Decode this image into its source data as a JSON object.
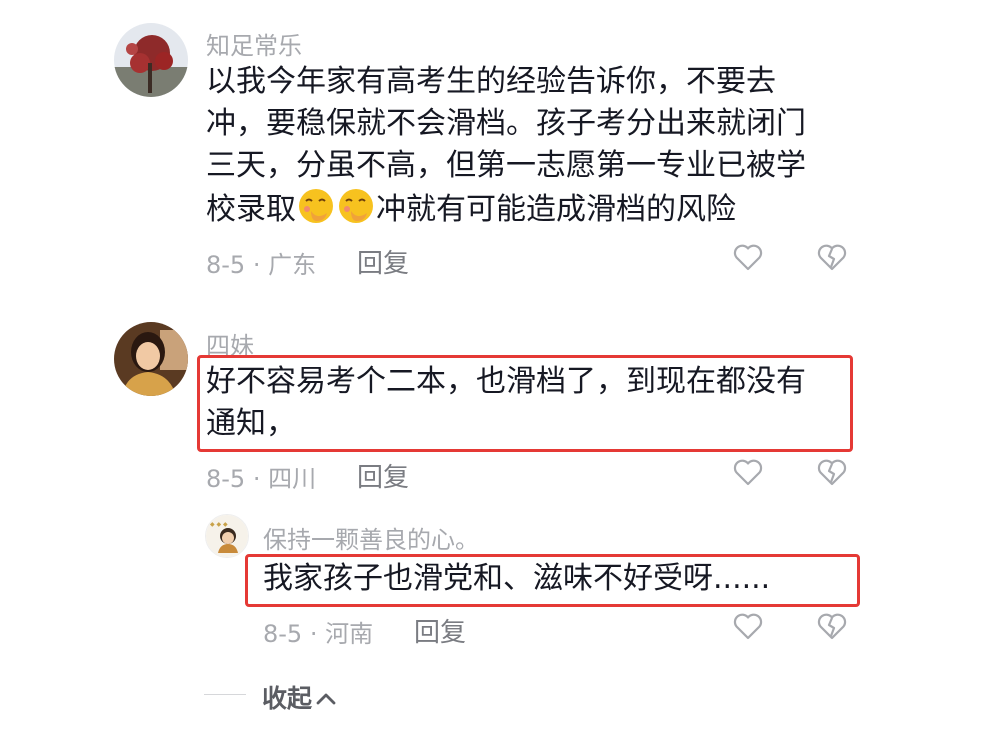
{
  "comments": [
    {
      "username": "知足常乐",
      "lines": [
        "以我今年家有高考生的经验告诉你，不要去",
        "冲，要稳保就不会滑档。孩子考分出来就闭门",
        "三天，分虽不高，但第一志愿第一专业已被学"
      ],
      "last_line_prefix": "校录取",
      "emoji": "face-with-hand-over-mouth",
      "last_line_suffix": "冲就有可能造成滑档的风险",
      "meta": "8-5 · 广东",
      "reply_label": "回复",
      "like_icon": "heart-outline-icon",
      "dislike_icon": "broken-heart-icon"
    },
    {
      "username": "四妹",
      "lines": [
        "好不容易考个二本，也滑档了，到现在都没有",
        "通知，"
      ],
      "meta": "8-5 · 四川",
      "reply_label": "回复",
      "highlighted": true,
      "highlight_color": "#e53935"
    },
    {
      "username": "保持一颗善良的心。",
      "lines": [
        "我家孩子也滑党和、滋味不好受呀......"
      ],
      "meta": "8-5 · 河南",
      "reply_label": "回复",
      "highlighted": true,
      "is_reply": true
    }
  ],
  "collapse_label": "收起",
  "colors": {
    "text_primary": "#161823",
    "text_secondary": "#a7a9ae",
    "highlight": "#e53935"
  }
}
